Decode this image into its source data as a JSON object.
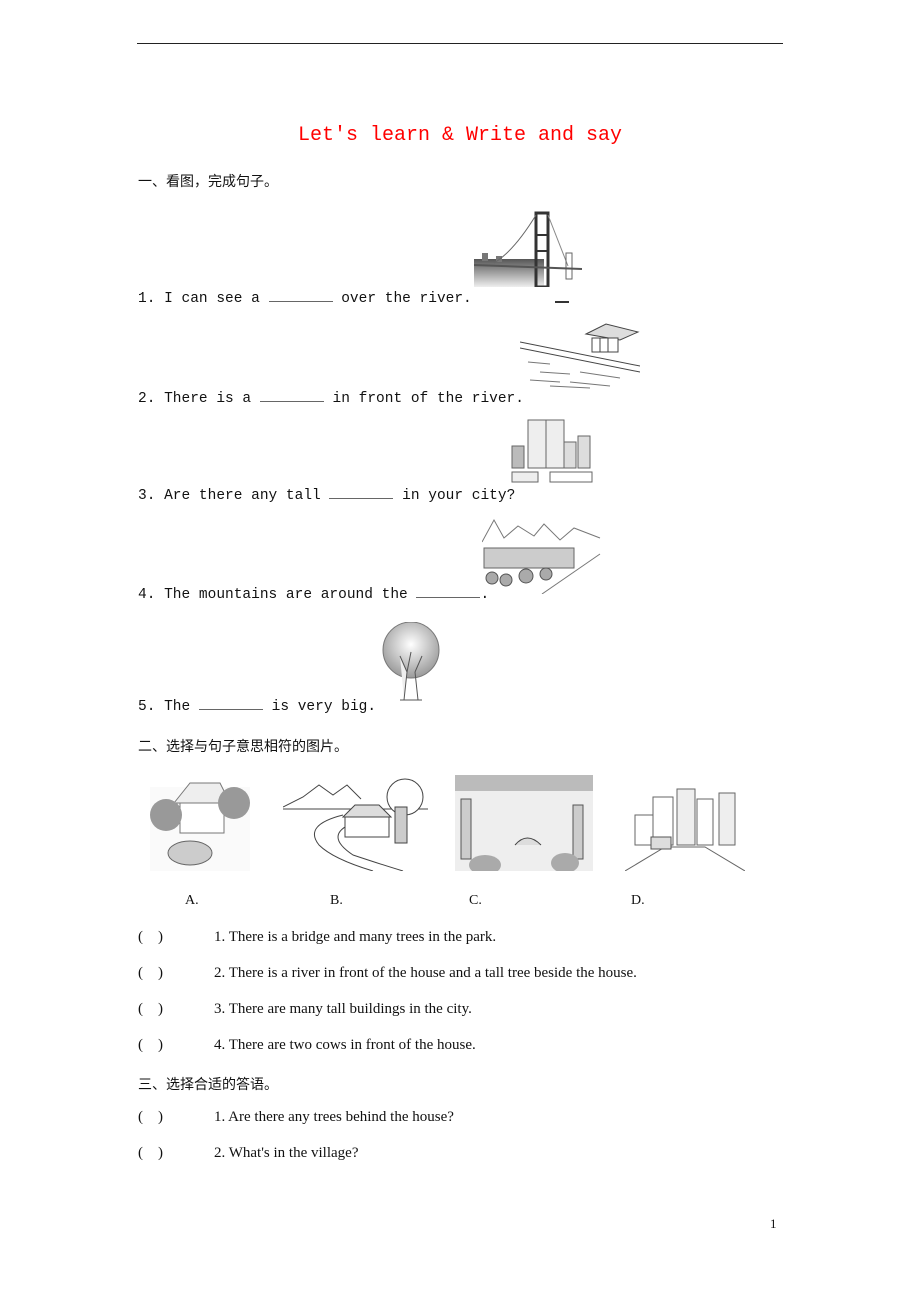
{
  "title": "Let's learn & Write and say",
  "sections": [
    {
      "heading": "一、看图，完成句子。",
      "questions": [
        {
          "num": "1.",
          "before": "I can see a",
          "after": "over the river.",
          "image": "bridge-image"
        },
        {
          "num": "2.",
          "before": "There is a",
          "after": "in front of the river.",
          "image": "house-by-river-image"
        },
        {
          "num": "3.",
          "before": "Are there any tall",
          "after": "in your city?",
          "image": "city-buildings-image"
        },
        {
          "num": "4.",
          "before": "The mountains are around the",
          "after": ".",
          "image": "village-mountains-image"
        },
        {
          "num": "5.",
          "before": "The",
          "after": "is very big.",
          "image": "tree-image"
        }
      ]
    },
    {
      "heading": "二、选择与句子意思相符的图片。",
      "options": [
        {
          "label": "A.",
          "image": "house-cows-image"
        },
        {
          "label": "B.",
          "image": "house-river-tree-image"
        },
        {
          "label": "C.",
          "image": "park-bridge-image"
        },
        {
          "label": "D.",
          "image": "city-street-image"
        }
      ],
      "items": [
        {
          "paren": "(    )",
          "text": "1. There is a bridge and many trees in the park."
        },
        {
          "paren": "(    )",
          "text": "2. There is a river in front of the house and a tall tree beside the house."
        },
        {
          "paren": "(    )",
          "text": "3. There are many tall buildings in the city."
        },
        {
          "paren": "(    )",
          "text": "4. There are two cows in front of the house."
        }
      ]
    },
    {
      "heading": "三、选择合适的答语。",
      "items": [
        {
          "paren": "(    )",
          "text": "1. Are there any trees behind the house?"
        },
        {
          "paren": "(    )",
          "text": "2. What's in the village?"
        }
      ]
    }
  ],
  "page_number": "1",
  "colors": {
    "title": "#ff0000",
    "text": "#111111"
  }
}
